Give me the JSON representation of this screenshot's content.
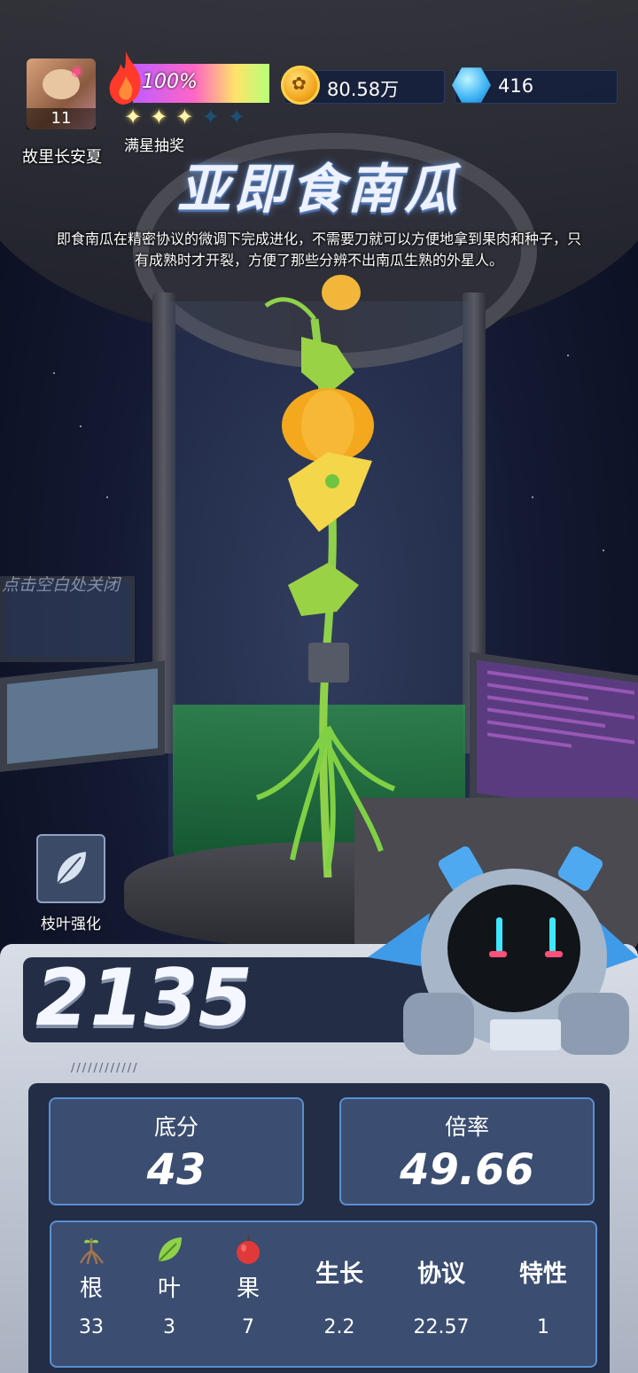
{
  "player": {
    "name": "故里长安夏",
    "level": "11",
    "energy_percent": "100%",
    "energy_fraction": 1.0,
    "stars_filled": 3,
    "stars_total": 5,
    "star_reward_label": "满星抽奖"
  },
  "currency": {
    "coins": "80.58万",
    "gems": "416",
    "coin_icon": "gold-coin-icon",
    "gem_icon": "blue-gem-icon"
  },
  "plant": {
    "title": "亚即食南瓜",
    "description": "即食南瓜在精密协议的微调下完成进化，不需要刀就可以方便地拿到果肉和种子，只有成熟时才开裂，方便了那些分辨不出南瓜生熟的外星人。"
  },
  "hints": {
    "close": "点击空白处关闭"
  },
  "actions": {
    "leaf_upgrade_label": "枝叶强化",
    "leaf_upgrade_icon": "leaf-icon"
  },
  "score": {
    "total": "2135",
    "base_label": "底分",
    "base_value": "43",
    "multiplier_label": "倍率",
    "multiplier_value": "49.66"
  },
  "stats": [
    {
      "label": "根",
      "value": "33",
      "icon": "root-icon"
    },
    {
      "label": "叶",
      "value": "3",
      "icon": "leaf-icon"
    },
    {
      "label": "果",
      "value": "7",
      "icon": "apple-icon"
    },
    {
      "label": "生长",
      "value": "2.2"
    },
    {
      "label": "协议",
      "value": "22.57"
    },
    {
      "label": "特性",
      "value": "1"
    }
  ],
  "colors": {
    "panel_dark": "#232d45",
    "card": "#3b4d70",
    "card_border": "#5a8fd0",
    "liquid": "#2f8a4c"
  }
}
